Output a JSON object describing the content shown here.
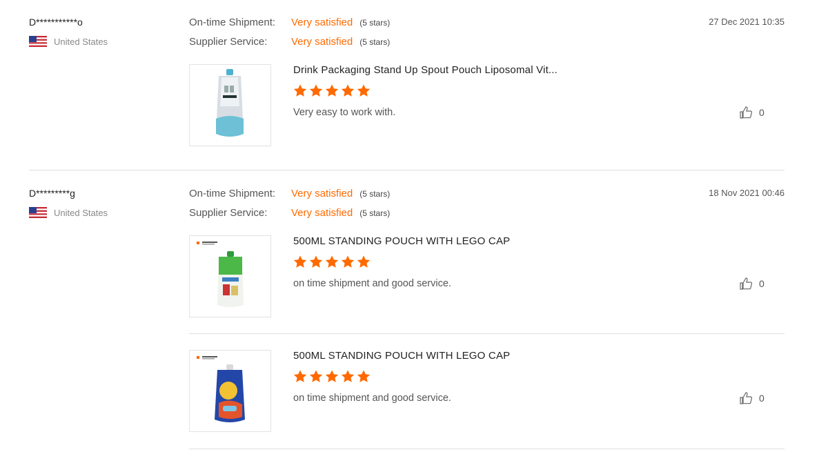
{
  "reviews": [
    {
      "reviewer": "D***********o",
      "country": "United States",
      "date": "27 Dec 2021 10:35",
      "ratings": [
        {
          "label": "On-time Shipment:",
          "value": "Very satisfied",
          "stars_text": "(5 stars)"
        },
        {
          "label": "Supplier Service:",
          "value": "Very satisfied",
          "stars_text": "(5 stars)"
        }
      ],
      "products": [
        {
          "title": "Drink Packaging Stand Up Spout Pouch Liposomal Vit...",
          "stars": 5,
          "comment": "Very easy to work with.",
          "likes": "0",
          "thumb_icon": "white-blue-spout-pouch"
        }
      ]
    },
    {
      "reviewer": "D*********g",
      "country": "United States",
      "date": "18 Nov 2021 00:46",
      "ratings": [
        {
          "label": "On-time Shipment:",
          "value": "Very satisfied",
          "stars_text": "(5 stars)"
        },
        {
          "label": "Supplier Service:",
          "value": "Very satisfied",
          "stars_text": "(5 stars)"
        }
      ],
      "products": [
        {
          "title": "500ML STANDING POUCH WITH LEGO CAP",
          "stars": 5,
          "comment": "on time shipment and good service.",
          "likes": "0",
          "thumb_icon": "green-lego-cap-pouch"
        },
        {
          "title": "500ML STANDING POUCH WITH LEGO CAP",
          "stars": 5,
          "comment": "on time shipment and good service.",
          "likes": "0",
          "thumb_icon": "blue-cartoon-lego-cap-pouch"
        }
      ]
    }
  ],
  "icons": {
    "flag": "us-flag-icon",
    "star": "star-icon",
    "like": "thumbs-up-icon"
  },
  "colors": {
    "accent": "#ff6a00",
    "divider": "#dedede"
  }
}
